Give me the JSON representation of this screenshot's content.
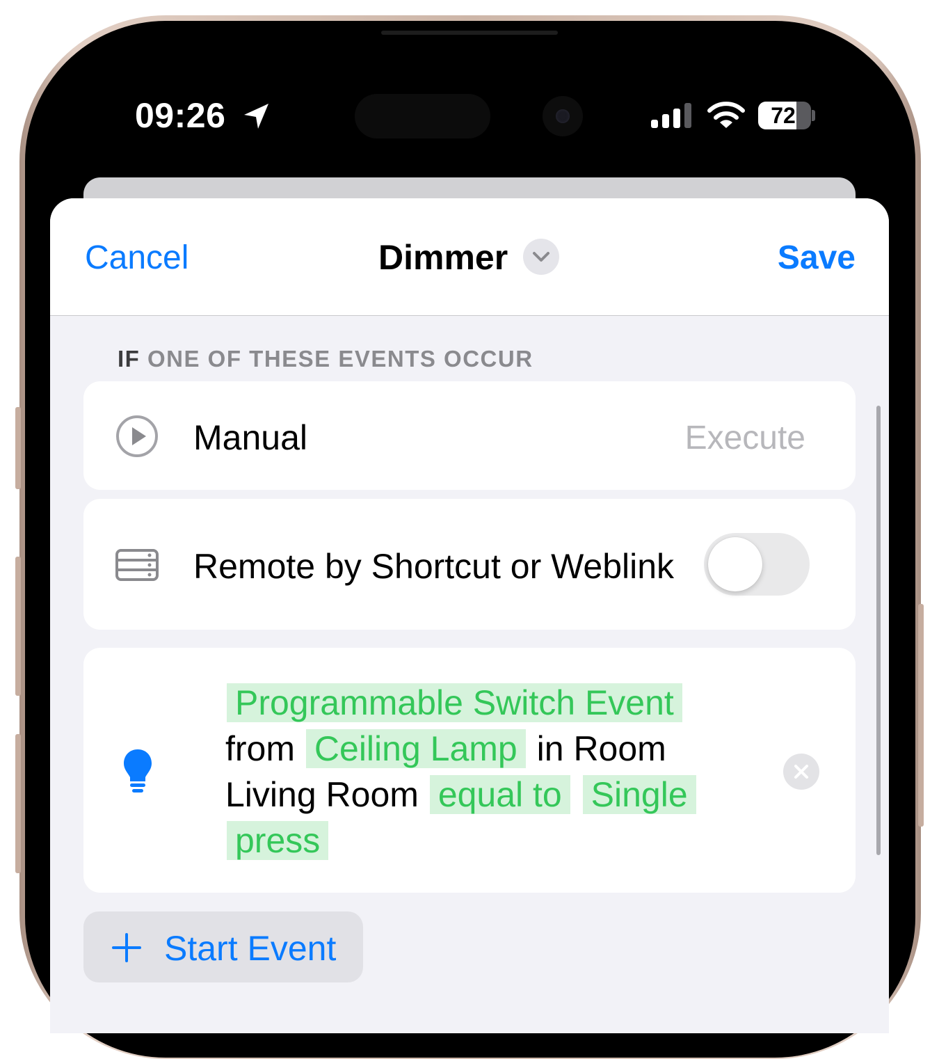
{
  "status_bar": {
    "time": "09:26",
    "battery": "72",
    "battery_level": 0.72,
    "icons": [
      "location-arrow-icon",
      "cellular-signal-icon",
      "wifi-icon",
      "battery-icon"
    ]
  },
  "nav": {
    "cancel_label": "Cancel",
    "title": "Dimmer",
    "save_label": "Save"
  },
  "section": {
    "header_if": "IF",
    "header_rest": " ONE OF THESE EVENTS OCCUR"
  },
  "events": {
    "manual": {
      "label": "Manual",
      "value": "Execute",
      "icon": "play-circle-icon"
    },
    "remote": {
      "label": "Remote by Shortcut or Weblink",
      "toggle_on": false,
      "icon": "server-rack-icon"
    },
    "rule": {
      "icon": "lightbulb-icon",
      "event_token": "Programmable Switch Event",
      "text_from": "from",
      "accessory_token": "Ceiling Lamp",
      "text_in_room": "in Room",
      "room_name": "Living Room",
      "operator_token": "equal to",
      "value_token": "Single press"
    }
  },
  "add_event": {
    "label": "Start Event"
  },
  "colors": {
    "accent": "#0a7bff",
    "token_text": "#34c759",
    "token_bg": "#d6f3dc",
    "background": "#f2f2f7"
  }
}
